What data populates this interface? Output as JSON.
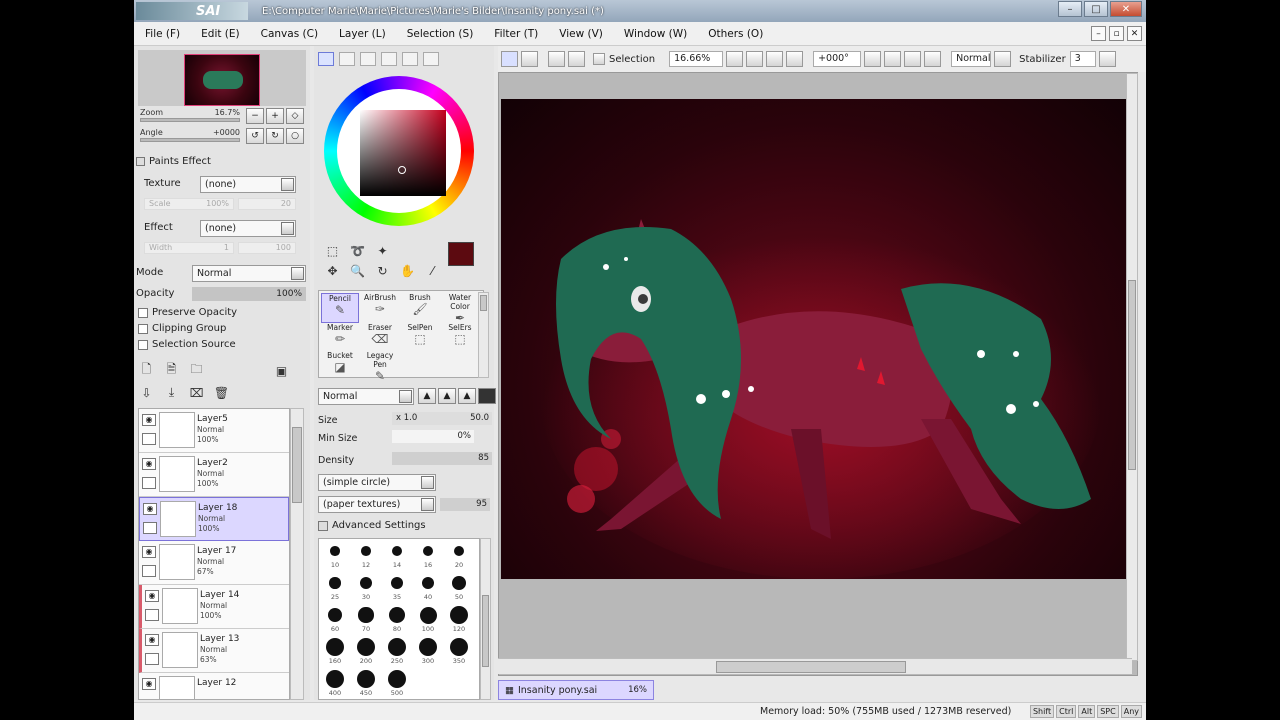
{
  "window": {
    "title": "E:\\Computer Marie\\Marie\\Pictures\\Marie's Bilder\\Insanity pony.sai (*)",
    "app_logo": "SAI"
  },
  "menu": [
    "File (F)",
    "Edit (E)",
    "Canvas (C)",
    "Layer (L)",
    "Selection (S)",
    "Filter (T)",
    "View (V)",
    "Window (W)",
    "Others (O)"
  ],
  "navigator": {
    "zoom_label": "Zoom",
    "zoom_value": "16.7%",
    "angle_label": "Angle",
    "angle_value": "+0000"
  },
  "paints_effect": {
    "header": "Paints Effect",
    "texture_label": "Texture",
    "texture_value": "(none)",
    "scale_label": "Scale",
    "scale_value": "100%",
    "scale_extra": "20",
    "effect_label": "Effect",
    "effect_value": "(none)",
    "width_label": "Width",
    "width_value": "1",
    "width_extra": "100"
  },
  "layer_props": {
    "mode_label": "Mode",
    "mode_value": "Normal",
    "opacity_label": "Opacity",
    "opacity_value": "100%",
    "opacity_fraction": 1.0,
    "preserve_opacity": "Preserve Opacity",
    "clipping_group": "Clipping Group",
    "selection_source": "Selection Source"
  },
  "layers": [
    {
      "name": "Layer5",
      "mode": "Normal",
      "opacity": "100%",
      "selected": false,
      "marked": false
    },
    {
      "name": "Layer2",
      "mode": "Normal",
      "opacity": "100%",
      "selected": false,
      "marked": false
    },
    {
      "name": "Layer 18",
      "mode": "Normal",
      "opacity": "100%",
      "selected": true,
      "marked": false
    },
    {
      "name": "Layer 17",
      "mode": "Normal",
      "opacity": "67%",
      "selected": false,
      "marked": false
    },
    {
      "name": "Layer 14",
      "mode": "Normal",
      "opacity": "100%",
      "selected": false,
      "marked": true
    },
    {
      "name": "Layer 13",
      "mode": "Normal",
      "opacity": "63%",
      "selected": false,
      "marked": true
    },
    {
      "name": "Layer 12",
      "mode": "",
      "opacity": "",
      "selected": false,
      "marked": false
    }
  ],
  "color": {
    "current": "#5c0a10",
    "background": "#f5f5f5"
  },
  "brushes": [
    {
      "label": "Pencil",
      "selected": true
    },
    {
      "label": "AirBrush",
      "selected": false
    },
    {
      "label": "Brush",
      "selected": false
    },
    {
      "label": "Water Color",
      "selected": false
    },
    {
      "label": "Marker",
      "selected": false
    },
    {
      "label": "Eraser",
      "selected": false
    },
    {
      "label": "SelPen",
      "selected": false
    },
    {
      "label": "SelErs",
      "selected": false
    },
    {
      "label": "Bucket",
      "selected": false
    },
    {
      "label": "Legacy Pen",
      "selected": false
    }
  ],
  "brush_params": {
    "blend_mode": "Normal",
    "size_label": "Size",
    "size_mult": "x 1.0",
    "size_value": "50.0",
    "min_size_label": "Min Size",
    "min_size_value": "0%",
    "density_label": "Density",
    "density_value": "85",
    "shape": "(simple circle)",
    "texture": "(paper textures)",
    "texture_value": "95",
    "advanced": "Advanced Settings"
  },
  "brush_sizes": [
    "10",
    "12",
    "14",
    "16",
    "20",
    "25",
    "30",
    "35",
    "40",
    "50",
    "60",
    "70",
    "80",
    "100",
    "120",
    "160",
    "200",
    "250",
    "300",
    "350",
    "400",
    "450",
    "500"
  ],
  "canvas_toolbar": {
    "selection_label": "Selection",
    "zoom": "16.66%",
    "angle": "+000°",
    "blend": "Normal",
    "stabilizer_label": "Stabilizer",
    "stabilizer_value": "3"
  },
  "document_tab": {
    "name": "Insanity pony.sai",
    "zoom": "16%"
  },
  "status": {
    "memory": "Memory load: 50% (755MB used / 1273MB reserved)",
    "keys": [
      "Shift",
      "Ctrl",
      "Alt",
      "SPC",
      "Any"
    ]
  }
}
